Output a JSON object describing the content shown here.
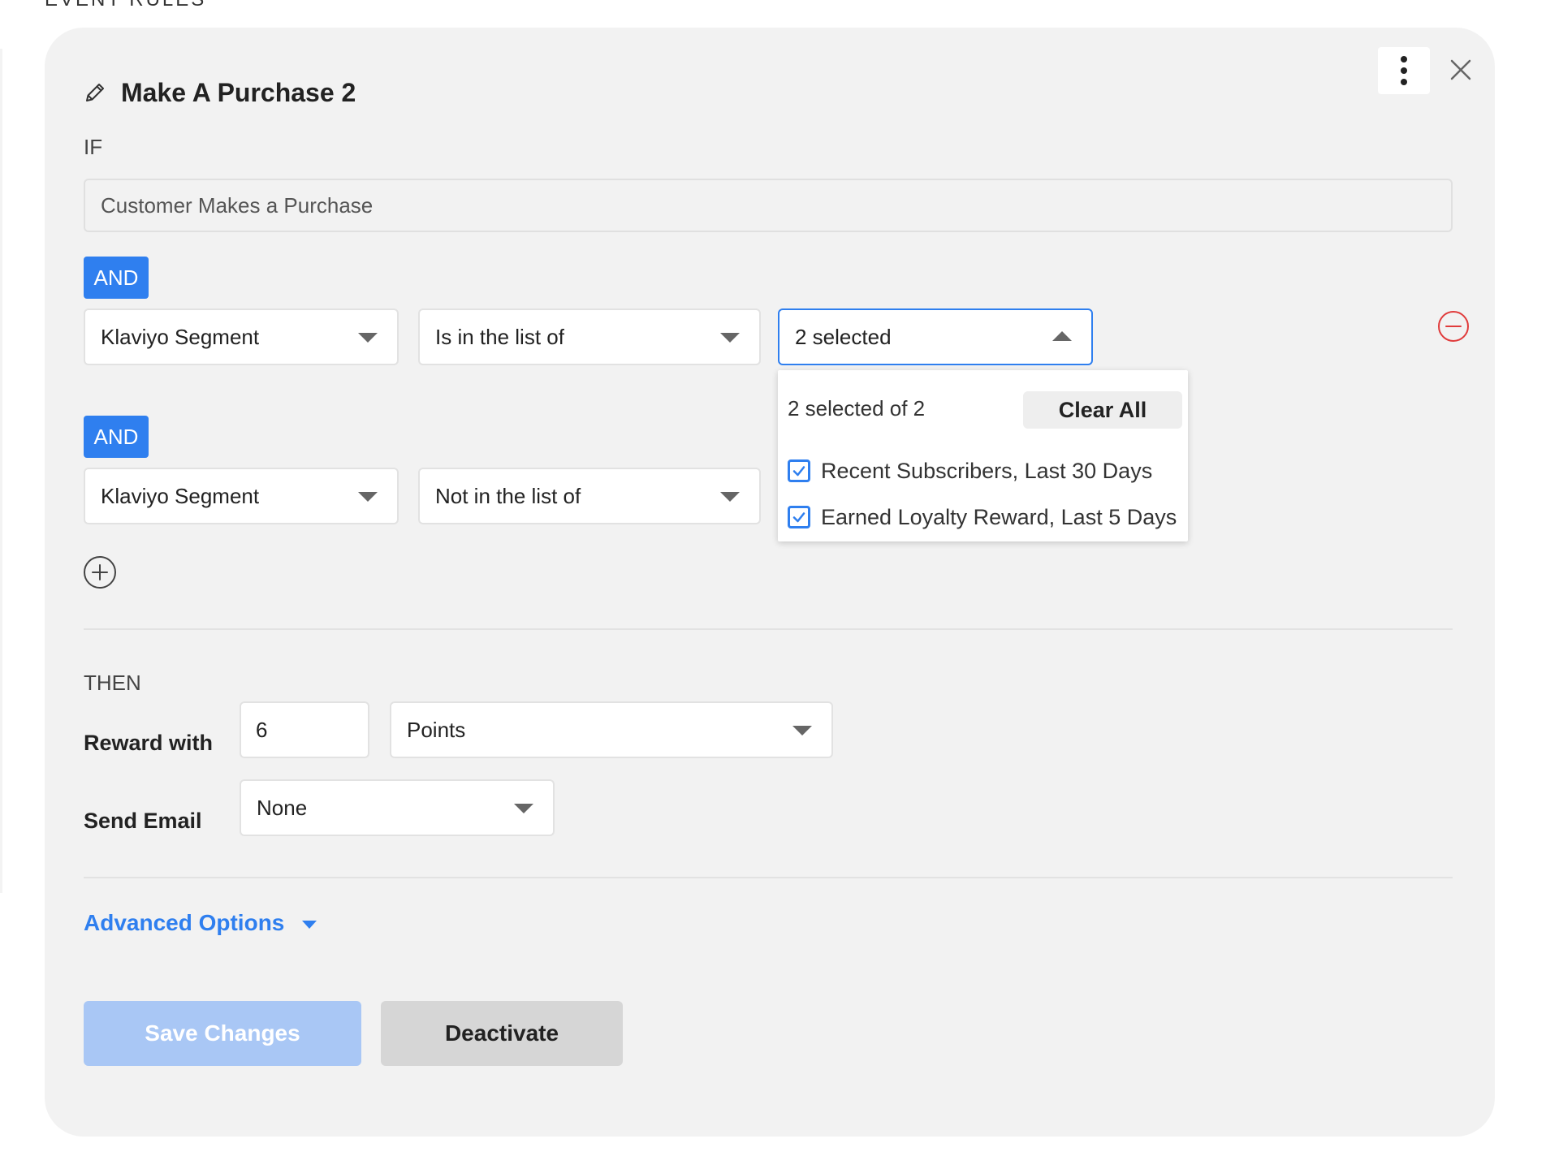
{
  "section": {
    "heading": "EVENT RULES"
  },
  "rule": {
    "title": "Make A Purchase 2",
    "if_label": "IF",
    "trigger": "Customer Makes a Purchase",
    "conditions": [
      {
        "connector": "AND",
        "field": "Klaviyo Segment",
        "operator": "Is in the list of",
        "value": "2 selected",
        "dropdown": {
          "summary": "2 selected of 2",
          "clear_label": "Clear All",
          "options": [
            {
              "label": "Recent Subscribers, Last 30 Days",
              "checked": true
            },
            {
              "label": "Earned Loyalty Reward, Last 5 Days",
              "checked": true
            }
          ]
        }
      },
      {
        "connector": "AND",
        "field": "Klaviyo Segment",
        "operator": "Not in the list of"
      }
    ],
    "then_label": "THEN",
    "reward": {
      "label": "Reward with",
      "amount": "6",
      "unit": "Points"
    },
    "email": {
      "label": "Send Email",
      "value": "None"
    },
    "advanced_label": "Advanced Options",
    "actions": {
      "save": "Save Changes",
      "deactivate": "Deactivate"
    }
  },
  "colors": {
    "accent": "#2f7fef",
    "danger": "#e03b3b",
    "card_bg": "#f2f2f2"
  },
  "icons": [
    "pencil-icon",
    "kebab-menu-icon",
    "close-icon",
    "remove-condition-icon",
    "add-condition-icon",
    "checkbox-checked-icon",
    "caret-down-icon",
    "caret-up-icon"
  ]
}
